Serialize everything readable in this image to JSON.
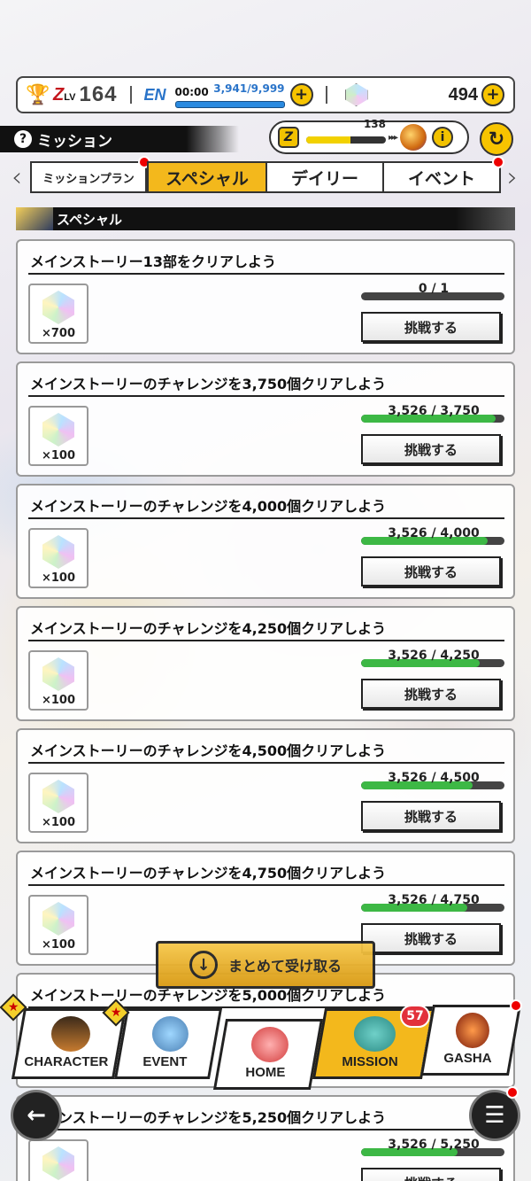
{
  "status": {
    "zlv_label": "Z",
    "zlv_small": "LV",
    "zlv_value": "164",
    "en_label": "EN",
    "en_time": "00:00",
    "en_count": "3,941/9,999",
    "gem_count": "494"
  },
  "header": {
    "title": "ミッション",
    "z_progress_value": "138",
    "z_progress_fraction": 0.55
  },
  "tabs": [
    {
      "label": "ミッションプラン",
      "active": false,
      "dot": true
    },
    {
      "label": "スペシャル",
      "active": true,
      "dot": false
    },
    {
      "label": "デイリー",
      "active": false,
      "dot": false
    },
    {
      "label": "イベント",
      "active": false,
      "dot": true
    }
  ],
  "section": {
    "title": "スペシャル"
  },
  "missions": [
    {
      "title": "メインストーリー13部をクリアしよう",
      "reward_qty": "×700",
      "progress": "0 / 1",
      "fraction": 0.0,
      "button": "挑戦する"
    },
    {
      "title": "メインストーリーのチャレンジを3,750個クリアしよう",
      "reward_qty": "×100",
      "progress": "3,526 / 3,750",
      "fraction": 0.94,
      "button": "挑戦する"
    },
    {
      "title": "メインストーリーのチャレンジを4,000個クリアしよう",
      "reward_qty": "×100",
      "progress": "3,526 / 4,000",
      "fraction": 0.88,
      "button": "挑戦する"
    },
    {
      "title": "メインストーリーのチャレンジを4,250個クリアしよう",
      "reward_qty": "×100",
      "progress": "3,526 / 4,250",
      "fraction": 0.83,
      "button": "挑戦する"
    },
    {
      "title": "メインストーリーのチャレンジを4,500個クリアしよう",
      "reward_qty": "×100",
      "progress": "3,526 / 4,500",
      "fraction": 0.78,
      "button": "挑戦する"
    },
    {
      "title": "メインストーリーのチャレンジを4,750個クリアしよう",
      "reward_qty": "×100",
      "progress": "3,526 / 4,750",
      "fraction": 0.74,
      "button": "挑戦する"
    },
    {
      "title": "メインストーリーのチャレンジを5,000個クリアしよう",
      "reward_qty": "",
      "progress": "",
      "fraction": 0.7,
      "button": ""
    },
    {
      "title": "メインストーリーのチャレンジを5,250個クリアしよう",
      "reward_qty": "",
      "progress": "3,526 / 5,250",
      "fraction": 0.67,
      "button": "挑戦する"
    }
  ],
  "receive_all": {
    "label": "まとめて受け取る"
  },
  "nav": {
    "character": "CHARACTER",
    "event": "EVENT",
    "home": "HOME",
    "mission": "MISSION",
    "gasha": "GASHA",
    "mission_badge": "57"
  }
}
